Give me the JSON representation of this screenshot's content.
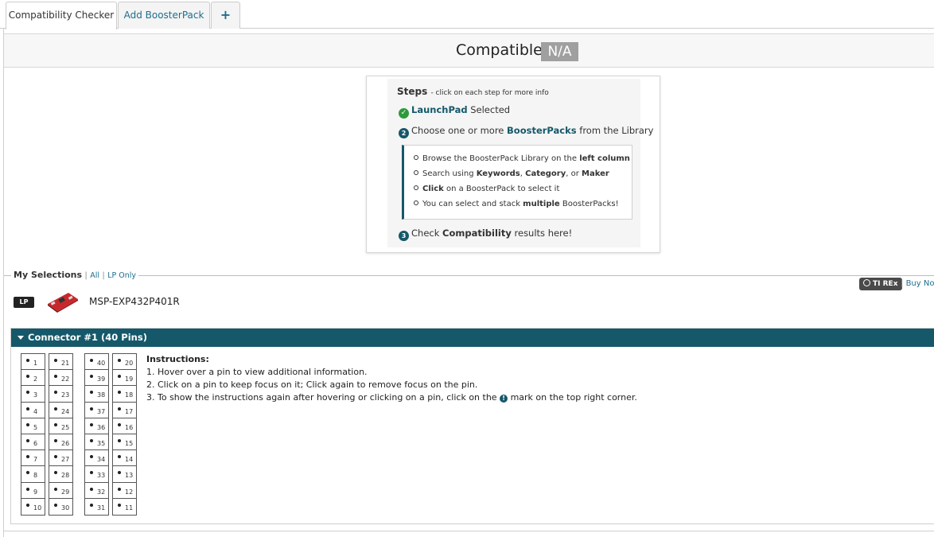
{
  "tabs": [
    {
      "label": "Compatibility Checker"
    },
    {
      "label": "Add BoosterPack"
    },
    {
      "label": "+"
    }
  ],
  "compat": {
    "label": "Compatible?",
    "status": "N/A"
  },
  "steps": {
    "title": "Steps",
    "subtitle": "- click on each step for more info",
    "step1": {
      "link": "LaunchPad",
      "text": " Selected"
    },
    "step2": {
      "number": "2",
      "pre": "Choose one or more ",
      "link": "BoosterPacks",
      "post": " from the Library"
    },
    "substeps": [
      {
        "pre": "Browse the BoosterPack Library on the ",
        "bold": "left column",
        "post": ""
      },
      {
        "pre": "Search using ",
        "bold1": "Keywords",
        "mid1": ", ",
        "bold2": "Category",
        "mid2": ", or ",
        "bold3": "Maker"
      },
      {
        "bold": "Click",
        "post": " on a BoosterPack to select it"
      },
      {
        "pre": "You can select and stack ",
        "bold": "multiple",
        "post": " BoosterPacks!"
      }
    ],
    "step3": {
      "number": "3",
      "pre": "Check ",
      "bold": "Compatibility",
      "post": " results here!"
    }
  },
  "selections": {
    "title": "My Selections",
    "link_all": "All",
    "link_lp": "LP Only",
    "sep": "|",
    "tirex": "TI REx",
    "buy": "Buy Now",
    "lp_badge": "LP",
    "board_name": "MSP-EXP432P401R"
  },
  "connector": {
    "title": "Connector #1 (40 Pins)",
    "columns": [
      [
        "1",
        "2",
        "3",
        "4",
        "5",
        "6",
        "7",
        "8",
        "9",
        "10"
      ],
      [
        "21",
        "22",
        "23",
        "24",
        "25",
        "26",
        "27",
        "28",
        "29",
        "30"
      ],
      [
        "40",
        "39",
        "38",
        "37",
        "36",
        "35",
        "34",
        "33",
        "32",
        "31"
      ],
      [
        "20",
        "19",
        "18",
        "17",
        "16",
        "15",
        "14",
        "13",
        "12",
        "11"
      ]
    ],
    "instructions": {
      "title": "Instructions:",
      "line1": "1. Hover over a pin to view additional information.",
      "line2": "2. Click on a pin to keep focus on it; Click again to remove focus on the pin.",
      "line3_pre": "3. To show the instructions again after hovering or clicking on a pin, click on the ",
      "line3_post": " mark on the top right corner."
    }
  },
  "colors": {
    "accent": "#15586a",
    "success": "#2e9a3c",
    "badge": "#a0a0a0",
    "link": "#1d6e8e"
  }
}
